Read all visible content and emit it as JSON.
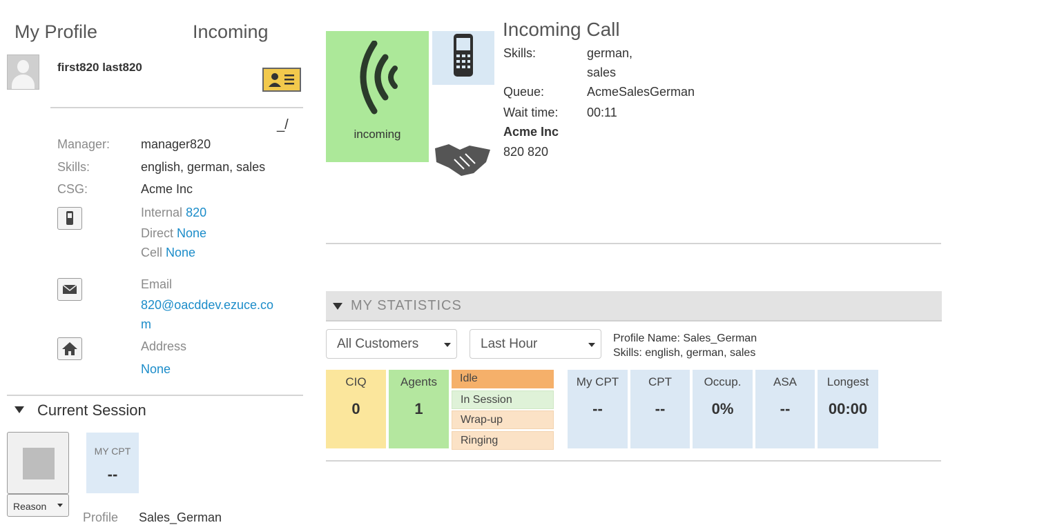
{
  "header": {
    "profile_title": "My Profile",
    "incoming_title": "Incoming"
  },
  "profile": {
    "name": "first820 last820",
    "manager_label": "Manager:",
    "manager": "manager820",
    "skills_label": "Skills:",
    "skills": "english, german, sales",
    "csg_label": "CSG:",
    "csg": "Acme Inc",
    "internal_label": "Internal",
    "internal": "820",
    "direct_label": "Direct",
    "direct": "None",
    "cell_label": "Cell",
    "cell": "None",
    "email_label": "Email",
    "email_line1": "820@oacddev.ezuce.co",
    "email_line2": "m",
    "address_label": "Address",
    "address": "None"
  },
  "session": {
    "title": "Current Session",
    "mycpt_label": "MY CPT",
    "mycpt_value": "--",
    "reason_label": "Reason",
    "profile_label": "Profile",
    "profile_value": "Sales_German"
  },
  "call": {
    "tile_label": "incoming",
    "title": "Incoming Call",
    "skills_label": "Skills:",
    "skills_line1": "german,",
    "skills_line2": "sales",
    "queue_label": "Queue:",
    "queue": "AcmeSalesGerman",
    "wait_label": "Wait time:",
    "wait": "00:11",
    "company": "Acme Inc",
    "caller": "820 820"
  },
  "stats": {
    "title": "MY STATISTICS",
    "customer_filter": "All Customers",
    "time_filter": "Last Hour",
    "profile_name": "Profile Name: Sales_German",
    "profile_skills": "Skills: english, german, sales",
    "ciq_label": "CIQ",
    "ciq_value": "0",
    "agents_label": "Agents",
    "agents_value": "1",
    "states": [
      "Idle",
      "In Session",
      "Wrap-up",
      "Ringing"
    ],
    "mycpt_label": "My CPT",
    "mycpt_value": "--",
    "cpt_label": "CPT",
    "cpt_value": "--",
    "occup_label": "Occup.",
    "occup_value": "0%",
    "asa_label": "ASA",
    "asa_value": "--",
    "longest_label": "Longest",
    "longest_value": "00:00"
  },
  "colors": {
    "incoming_green": "#ace899",
    "tile_blue": "#d9e8f4",
    "ciq_yellow": "#fbe69c",
    "agents_green": "#b4e79f",
    "idle_orange": "#f5b06a",
    "link_blue": "#1b8cc9"
  }
}
